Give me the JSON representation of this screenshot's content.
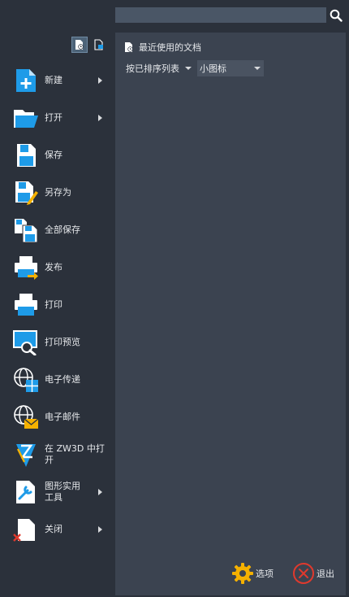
{
  "search": {
    "placeholder": "",
    "value": ""
  },
  "panel": {
    "title": "最近使用的文档",
    "sort_dropdown": "按已排序列表",
    "size_dropdown": "小图标"
  },
  "menu": {
    "new": "新建",
    "open": "打开",
    "save": "保存",
    "save_as": "另存为",
    "save_all": "全部保存",
    "publish": "发布",
    "print": "打印",
    "print_preview": "打印预览",
    "etransmit": "电子传递",
    "email": "电子邮件",
    "open_in_zw3d_line1": "在 ZW3D 中打",
    "open_in_zw3d_line2": "开",
    "drawing_utilities_line1": "图形实用",
    "drawing_utilities_line2": "工具",
    "close": "关闭"
  },
  "footer": {
    "options": "选项",
    "exit": "退出"
  },
  "colors": {
    "accent_blue": "#1e9be8",
    "gear_yellow": "#f5b100",
    "exit_red": "#e0392d"
  }
}
